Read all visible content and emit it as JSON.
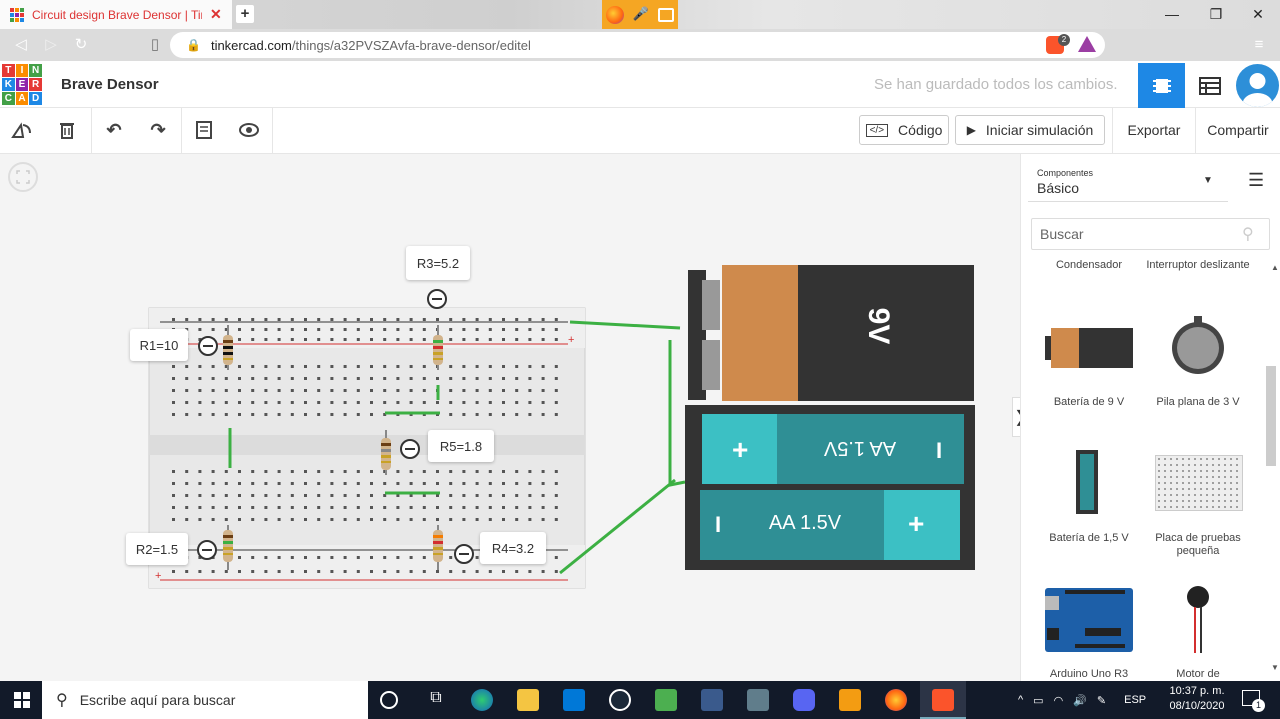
{
  "browser": {
    "tab_title": "Circuit design Brave Densor | Tinke",
    "url_host": "tinkercad.com",
    "url_path": "/things/a32PVSZAvfa-brave-densor/editel",
    "new_tab": "+",
    "shield_count": "2"
  },
  "app": {
    "logo_letters": [
      "T",
      "I",
      "N",
      "K",
      "E",
      "R",
      "C",
      "A",
      "D"
    ],
    "project_name": "Brave Densor",
    "save_status": "Se han guardado todos los cambios."
  },
  "toolbar": {
    "code_label": "Código",
    "simulate_label": "Iniciar simulación",
    "export_label": "Exportar",
    "share_label": "Compartir"
  },
  "circuit": {
    "labels": {
      "r1": "R1=10",
      "r2": "R2=1.5",
      "r3": "R3=5.2",
      "r4": "R4=3.2",
      "r5": "R5=1.8"
    },
    "battery_9v_text": "9V",
    "aa_top_text": "AA 1.5V",
    "aa_bottom_text": "AA 1.5V",
    "plus": "+",
    "minus": "I",
    "rail_plus": "+",
    "rail_minus": "-"
  },
  "panel": {
    "components_label": "Componentes",
    "components_value": "Básico",
    "search_placeholder": "Buscar",
    "top_labels": [
      "Condensador",
      "Interruptor deslizante"
    ],
    "items": [
      "Batería de 9 V",
      "Pila plana de 3 V",
      "Batería de 1,5 V",
      "Placa de pruebas pequeña",
      "Arduino Uno R3",
      "Motor de"
    ]
  },
  "taskbar": {
    "search_text": "Escribe aquí para buscar",
    "lang": "ESP",
    "time": "10:37 p. m.",
    "date": "08/10/2020",
    "notif_count": "1"
  },
  "colors": {
    "accent_blue": "#1e88e5",
    "wire_green": "#3cb043",
    "battery_orange": "#cf8a4c",
    "aa_teal": "#2f8f95"
  }
}
